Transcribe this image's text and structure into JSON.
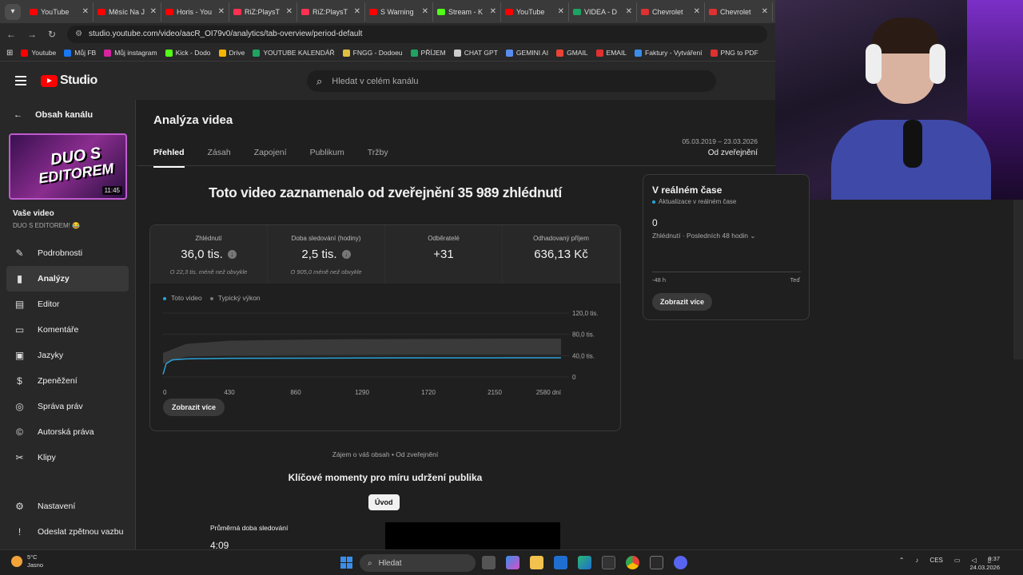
{
  "browser": {
    "tabs": [
      {
        "label": "YouTube",
        "color": "#ff0000"
      },
      {
        "label": "Měsíc Na J",
        "color": "#ff0000"
      },
      {
        "label": "Horis - You",
        "color": "#ff0000"
      },
      {
        "label": "RiZ:PlaysT",
        "color": "#ff3050"
      },
      {
        "label": "RiZ:PlaysT",
        "color": "#ff3050"
      },
      {
        "label": "S Warning",
        "color": "#ff0000"
      },
      {
        "label": "Stream - K",
        "color": "#53fc18"
      },
      {
        "label": "YouTube",
        "color": "#ff0000"
      },
      {
        "label": "VIDEA - D",
        "color": "#1ea362"
      },
      {
        "label": "Chevrolet",
        "color": "#e03030"
      },
      {
        "label": "Chevrolet",
        "color": "#e03030"
      }
    ],
    "url": "studio.youtube.com/video/aacR_OI79v0/analytics/tab-overview/period-default",
    "bookmarks": [
      {
        "label": "Youtube",
        "color": "#ff0000"
      },
      {
        "label": "Můj FB",
        "color": "#1877f2"
      },
      {
        "label": "Můj instagram",
        "color": "#d6249f"
      },
      {
        "label": "Kick - Dodo",
        "color": "#53fc18"
      },
      {
        "label": "Drive",
        "color": "#f4b400"
      },
      {
        "label": "YOUTUBE KALENDÁŘ",
        "color": "#1ea362"
      },
      {
        "label": "FNGG - Dodoeu",
        "color": "#e0c040"
      },
      {
        "label": "PŘÍJEM",
        "color": "#1ea362"
      },
      {
        "label": "CHAT GPT",
        "color": "#cccccc"
      },
      {
        "label": "GEMINI AI",
        "color": "#5a8cf0"
      },
      {
        "label": "GMAIL",
        "color": "#ea4335"
      },
      {
        "label": "EMAIL",
        "color": "#e03030"
      },
      {
        "label": "Faktury - Vytváření",
        "color": "#3a8eea"
      },
      {
        "label": "PNG to PDF",
        "color": "#e03030"
      }
    ]
  },
  "header": {
    "logo_text": "Studio",
    "search_placeholder": "Hledat v celém kanálu"
  },
  "sidebar": {
    "back_label": "Obsah kanálu",
    "thumb_line1": "DUO S",
    "thumb_line2": "EDITOREM",
    "duration": "11:45",
    "your_video": "Vaše video",
    "video_title": "DUO S EDITOREM! 😂",
    "items": [
      {
        "label": "Podrobnosti",
        "icon": "✎"
      },
      {
        "label": "Analýzy",
        "icon": "▮"
      },
      {
        "label": "Editor",
        "icon": "▤"
      },
      {
        "label": "Komentáře",
        "icon": "▭"
      },
      {
        "label": "Jazyky",
        "icon": "▣"
      },
      {
        "label": "Zpeněžení",
        "icon": "$"
      },
      {
        "label": "Správa práv",
        "icon": "◎"
      },
      {
        "label": "Autorská práva",
        "icon": "©"
      },
      {
        "label": "Klipy",
        "icon": "✂"
      }
    ],
    "bottom": [
      {
        "label": "Nastavení",
        "icon": "⚙"
      },
      {
        "label": "Odeslat zpětnou vazbu",
        "icon": "!"
      }
    ]
  },
  "main": {
    "title": "Analýza videa",
    "tabs": [
      "Přehled",
      "Zásah",
      "Zapojení",
      "Publikum",
      "Tržby"
    ],
    "date_range": "05.03.2019 – 23.03.2026",
    "period": "Od zveřejnění",
    "headline": "Toto video zaznamenalo od zveřejnění 35 989 zhlédnutí",
    "metrics": [
      {
        "label": "Zhlédnutí",
        "value": "36,0 tis.",
        "compare": "O 22,3 tis. méně než obvykle"
      },
      {
        "label": "Doba sledování (hodiny)",
        "value": "2,5 tis.",
        "compare": "O 905,0 méně než obvykle"
      },
      {
        "label": "Odběratelé",
        "value": "+31",
        "compare": ""
      },
      {
        "label": "Odhadovaný příjem",
        "value": "636,13 Kč",
        "compare": ""
      }
    ],
    "legend_this": "Toto video",
    "legend_typical": "Typický výkon",
    "show_more": "Zobrazit více",
    "interest": "Zájem o váš obsah • Od zveřejnění",
    "key_moments": "Klíčové momenty pro míru udržení publika",
    "intro_button": "Úvod",
    "avg_label": "Průměrná doba sledování",
    "avg_value": "4:09"
  },
  "chart_data": {
    "type": "line",
    "xlabel": "",
    "ylabel": "",
    "x_ticks": [
      "0",
      "430",
      "860",
      "1290",
      "1720",
      "2150",
      "2580 dní"
    ],
    "y_ticks": [
      "120,0 tis.",
      "80,0 tis.",
      "40,0 tis.",
      "0"
    ],
    "ylim": [
      0,
      120000
    ],
    "xlim": [
      0,
      2580
    ],
    "series": [
      {
        "name": "Toto video",
        "color": "#2aa4d8",
        "x": [
          0,
          20,
          60,
          150,
          430,
          860,
          1290,
          1720,
          2150,
          2580
        ],
        "y": [
          5000,
          25000,
          32000,
          34000,
          35000,
          35300,
          35600,
          35800,
          35900,
          35989
        ]
      },
      {
        "name": "Typický výkon",
        "color": "#3a3a3a",
        "x": [
          0,
          150,
          430,
          860,
          1290,
          1720,
          2150,
          2580
        ],
        "y_low": [
          25000,
          38000,
          40000,
          41000,
          41500,
          42000,
          42000,
          42000
        ],
        "y_high": [
          45000,
          62000,
          68000,
          70000,
          71000,
          71500,
          72000,
          72000
        ]
      }
    ]
  },
  "realtime": {
    "title": "V reálném čase",
    "subtitle": "Aktualizace v reálném čase",
    "value": "0",
    "period": "Zhlédnutí · Posledních 48 hodin",
    "axis_start": "-48 h",
    "axis_end": "Teď",
    "button": "Zobrazit více"
  },
  "taskbar": {
    "temp": "5°C",
    "weather": "Jasno",
    "search": "Hledat",
    "lang": "CES",
    "time": "0:37",
    "date": "24.03.2026"
  }
}
